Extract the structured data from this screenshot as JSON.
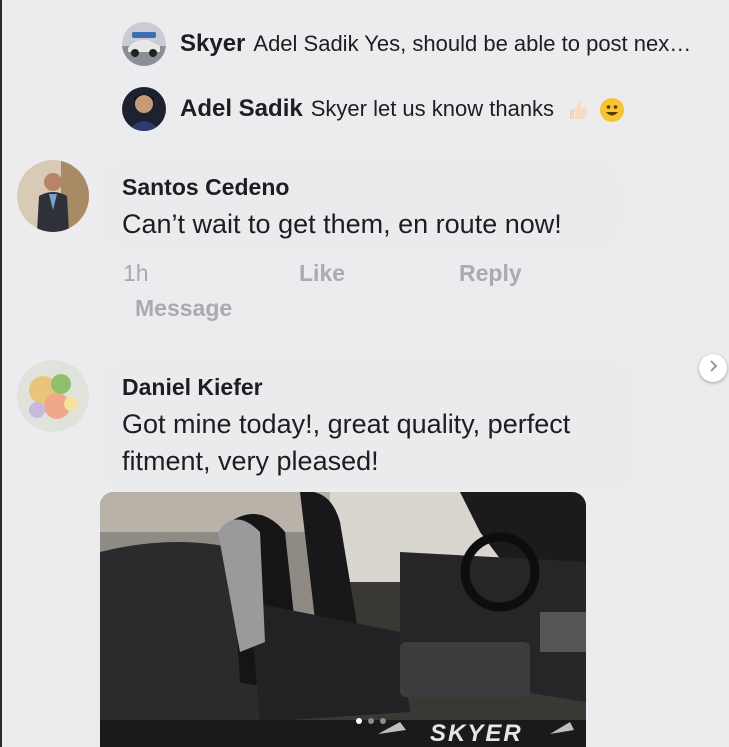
{
  "replies": [
    {
      "name": "Skyer",
      "text": "Adel Sadik Yes, should be able to post nex…"
    },
    {
      "name": "Adel Sadik",
      "text": "Skyer let us know thanks"
    }
  ],
  "comments": [
    {
      "name": "Santos Cedeno",
      "text": "Can’t wait to get them, en route now!",
      "time": "1h",
      "like": "Like",
      "reply": "Reply",
      "message": "Message"
    },
    {
      "name": "Daniel Kiefer",
      "text_line1": "Got mine today!, great quality, perfect",
      "text_line2": "fitment, very pleased!"
    }
  ],
  "photo": {
    "watermark": "SKYER",
    "dots": 3,
    "active_dot": 0
  },
  "colors": {
    "background": "#ececee",
    "action_text": "#a9abb1",
    "name_text": "#1c1e21"
  },
  "icons": {
    "next": "chevron-right-icon",
    "emoji1": "thumbs-up-icon",
    "emoji2": "smiley-icon"
  }
}
